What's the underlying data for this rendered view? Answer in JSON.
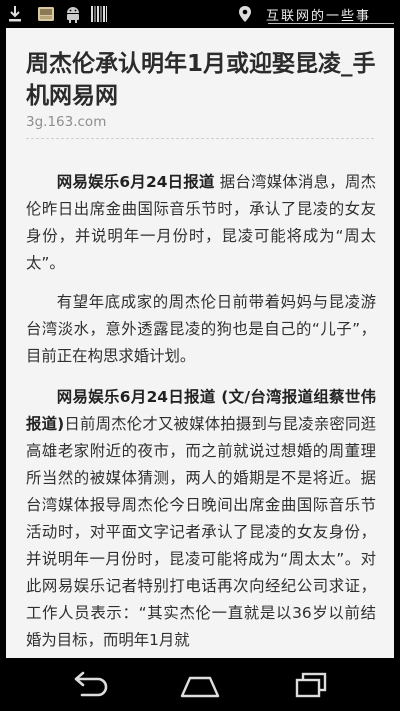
{
  "status_bar": {
    "icons": [
      "download-icon",
      "gallery-icon",
      "android-icon",
      "barcode-icon",
      "location-icon"
    ],
    "watermark": "互联网的一些事"
  },
  "article": {
    "title": "周杰伦承认明年1月或迎娶昆凌_手机网易网",
    "source": "3g.163.com",
    "paragraphs": [
      {
        "lead": "网易娱乐6月24日报道",
        "text": " 据台湾媒体消息，周杰伦昨日出席金曲国际音乐节时，承认了昆凌的女友身份，并说明年一月份时，昆凌可能将成为“周太太”。"
      },
      {
        "lead": "",
        "text": "有望年底成家的周杰伦日前带着妈妈与昆凌游台湾淡水，意外透露昆凌的狗也是自己的“儿子”，目前正在构思求婚计划。"
      },
      {
        "lead": "网易娱乐6月24日报道 (文/台湾报道组蔡世伟报道)",
        "text": "日前周杰伦才又被媒体拍摄到与昆凌亲密同逛高雄老家附近的夜市，而之前就说过想婚的周董理所当然的被媒体猜测，两人的婚期是不是将近。据台湾媒体报导周杰伦今日晚间出席金曲国际音乐节活动时，对平面文字记者承认了昆凌的女友身份，并说明年一月份时，昆凌可能将成为“周太太”。对此网易娱乐记者特别打电话再次向经纪公司求证，工作人员表示：“其实杰伦一直就是以36岁以前结婚为目标，而明年1月就"
      }
    ]
  },
  "nav_bar": {
    "buttons": [
      "back-icon",
      "home-icon",
      "recent-apps-icon"
    ]
  },
  "colors": {
    "page_background": "#f4f4f4",
    "text": "#303030",
    "source": "#8e8e8e",
    "bars": "#000000"
  }
}
